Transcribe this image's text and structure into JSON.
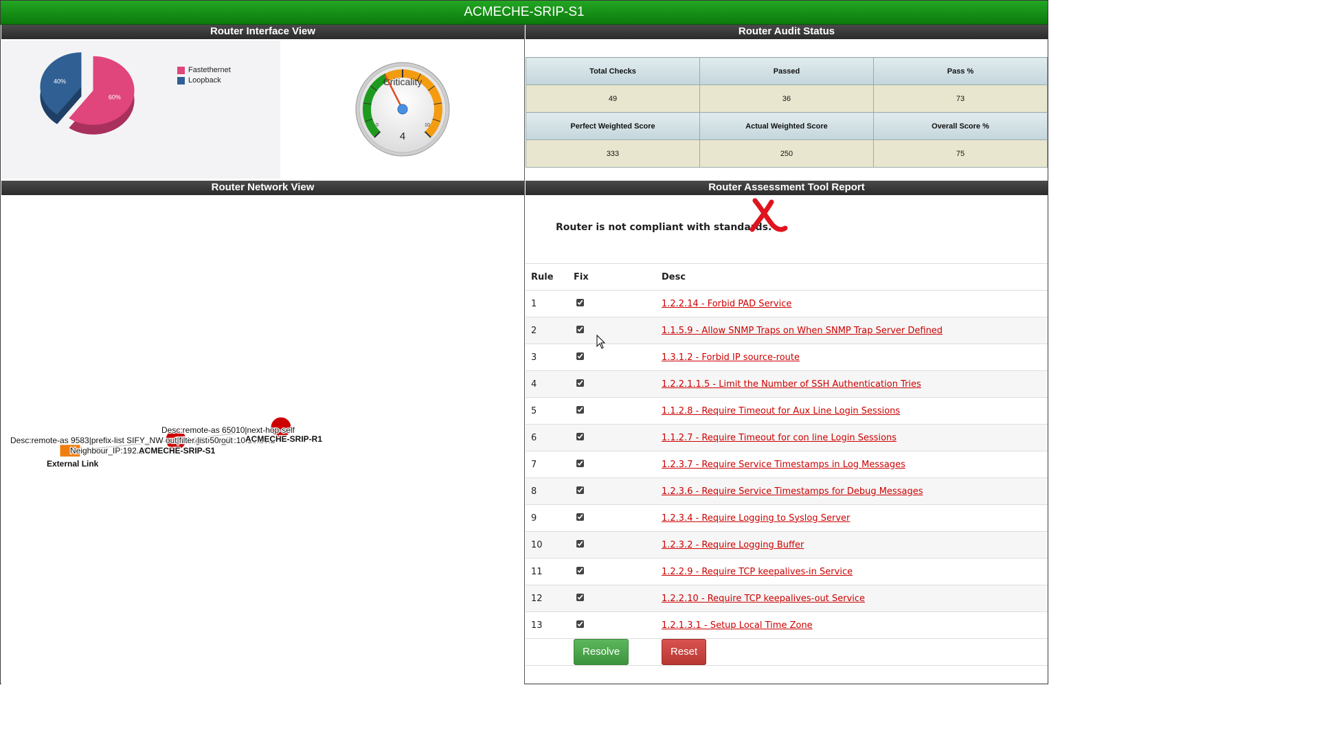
{
  "window": {
    "title": "ACMECHE-SRIP-S1"
  },
  "panels": {
    "interface_view": "Router Interface View",
    "audit_status": "Router Audit Status",
    "network_view": "Router Network View",
    "assessment_report": "Router Assessment Tool Report"
  },
  "chart_data": [
    {
      "type": "pie",
      "title": "",
      "labels": [
        "Fastethernet",
        "Loopback"
      ],
      "values": [
        60,
        40
      ],
      "value_labels": [
        "60%",
        "40%"
      ],
      "colors": [
        "#e0457b",
        "#2f5f93"
      ],
      "legend": "top-right"
    }
  ],
  "gauge": {
    "label": "Criticality",
    "value": 4,
    "min": 0,
    "max": 10,
    "min_label": "0",
    "max_label": "10",
    "value_label": "4"
  },
  "audit": {
    "headers_row1": [
      "Total Checks",
      "Passed",
      "Pass %"
    ],
    "values_row1": [
      "49",
      "36",
      "73"
    ],
    "headers_row2": [
      "Perfect Weighted Score",
      "Actual Weighted Score",
      "Overall Score %"
    ],
    "values_row2": [
      "333",
      "250",
      "75"
    ]
  },
  "network": {
    "labels": {
      "desc1": "Desc:remote-as 65010|next-hop-self",
      "neighbour1": "Neighbour_IP:10.10.20.2",
      "r1_name": "ACMECHE-SRIP-R1",
      "desc2": "Desc:remote-as 9583|prefix-list SIFY_NW out|filter-list 50 out",
      "neighbour2": "Neighbour_IP:192.168.6.5",
      "s1_name": "ACMECHE-SRIP-S1",
      "external": "External Link"
    }
  },
  "report": {
    "compliance_message": "Router is not compliant with standards.",
    "columns": [
      "Rule",
      "Fix",
      "Desc"
    ],
    "rules": [
      {
        "rule": "1",
        "desc": "1.2.2.14 - Forbid PAD Service"
      },
      {
        "rule": "2",
        "desc": "1.1.5.9 - Allow SNMP Traps on When SNMP Trap Server Defined"
      },
      {
        "rule": "3",
        "desc": "1.3.1.2 - Forbid IP source-route"
      },
      {
        "rule": "4",
        "desc": "1.2.2.1.1.5 - Limit the Number of SSH Authentication Tries"
      },
      {
        "rule": "5",
        "desc": "1.1.2.8 - Require Timeout for Aux Line Login Sessions"
      },
      {
        "rule": "6",
        "desc": "1.1.2.7 - Require Timeout for con line Login Sessions"
      },
      {
        "rule": "7",
        "desc": "1.2.3.7 - Require Service Timestamps in Log Messages"
      },
      {
        "rule": "8",
        "desc": "1.2.3.6 - Require Service Timestamps for Debug Messages"
      },
      {
        "rule": "9",
        "desc": "1.2.3.4 - Require Logging to Syslog Server"
      },
      {
        "rule": "10",
        "desc": "1.2.3.2 - Require Logging Buffer"
      },
      {
        "rule": "11",
        "desc": "1.2.2.9 - Require TCP keepalives-in Service"
      },
      {
        "rule": "12",
        "desc": "1.2.2.10 - Require TCP keepalives-out Service"
      },
      {
        "rule": "13",
        "desc": "1.2.1.3.1 - Setup Local Time Zone"
      }
    ],
    "resolve_label": "Resolve",
    "reset_label": "Reset"
  }
}
